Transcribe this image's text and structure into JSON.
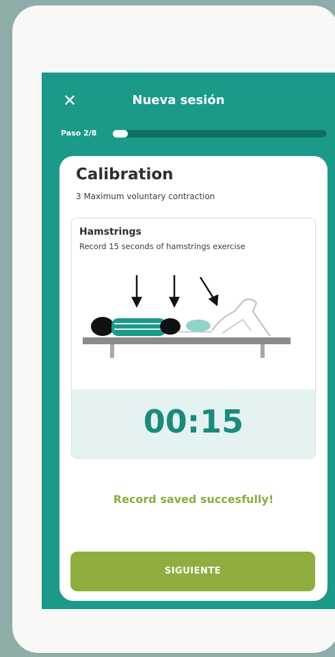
{
  "header": {
    "close_icon": "close-icon",
    "title": "Nueva sesión"
  },
  "progress": {
    "label": "Paso 2/8",
    "current_step": 2,
    "total_steps": 8
  },
  "card": {
    "title": "Calibration",
    "subtitle": "3 Maximum voluntary contraction",
    "exercise": {
      "name": "Hamstrings",
      "description": "Record 15 seconds of hamstrings exercise",
      "illustration_icon": "hamstrings-exercise-illustration"
    },
    "timer": "00:15",
    "status_message": "Record saved succesfully!",
    "next_button": "SIGUIENTE"
  },
  "colors": {
    "primary": "#1b9a89",
    "accent_green": "#8fae3f",
    "timer_bg": "#e4f3f2",
    "timer_text": "#1b8a7b",
    "background": "#8fada8"
  }
}
